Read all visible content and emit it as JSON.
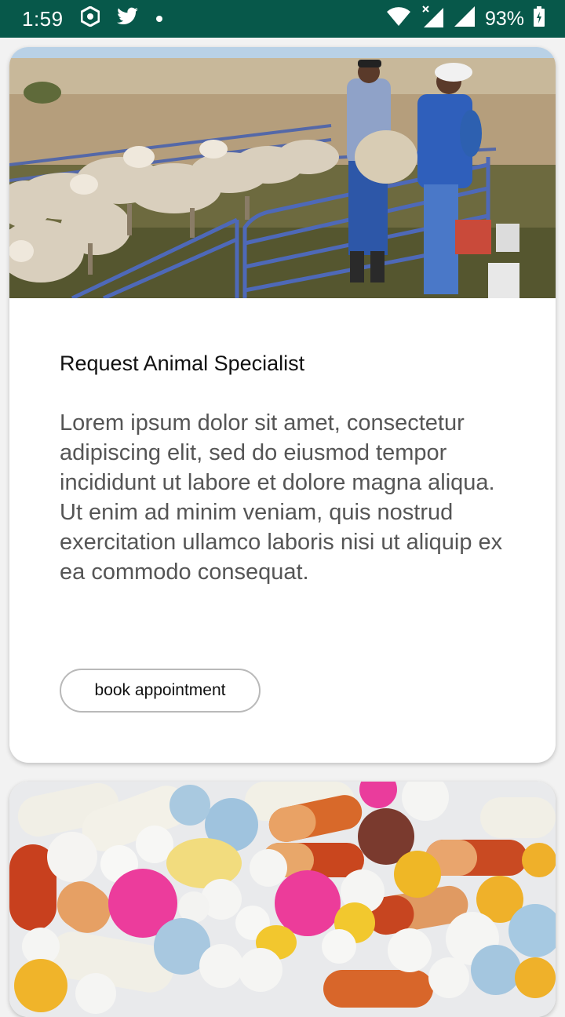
{
  "status_bar": {
    "time": "1:59",
    "battery": "93%",
    "icons": [
      "app-notification-icon",
      "twitter-icon",
      "notification-dot-icon",
      "wifi-icon",
      "signal-no-data-icon",
      "signal-icon",
      "battery-charging-icon"
    ],
    "background": "#07584a"
  },
  "cards": [
    {
      "image": "sheep-farmers-photo",
      "title": "Request Animal Specialist",
      "body": "Lorem ipsum dolor sit amet, consectetur adipiscing elit, sed do eiusmod tempor incididunt ut labore et dolore magna aliqua. Ut enim ad minim veniam, quis nostrud exercitation ullamco laboris nisi ut aliquip ex ea commodo consequat.",
      "button_label": "book appointment"
    },
    {
      "image": "medicine-pills-photo"
    }
  ]
}
